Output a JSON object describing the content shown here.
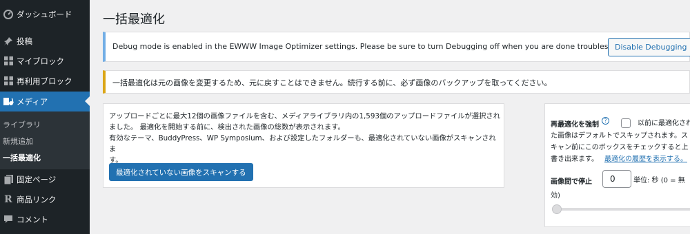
{
  "sidebar": {
    "items": [
      {
        "label": "ダッシュボード",
        "icon": "dashboard-icon"
      },
      {
        "label": "投稿",
        "icon": "pin-icon"
      },
      {
        "label": "マイブロック",
        "icon": "grid-icon"
      },
      {
        "label": "再利用ブロック",
        "icon": "grid-icon"
      },
      {
        "label": "メディア",
        "icon": "media-icon"
      },
      {
        "label": "固定ページ",
        "icon": "page-icon"
      },
      {
        "label": "商品リンク",
        "icon": "r-icon"
      },
      {
        "label": "コメント",
        "icon": "comment-icon"
      }
    ],
    "submenu": [
      "ライブラリ",
      "新規追加",
      "一括最適化"
    ]
  },
  "page_title": "一括最適化",
  "notice_debug": {
    "text": "Debug mode is enabled in the EWWW Image Optimizer settings. Please be sure to turn Debugging off when you are done troubleshooting.",
    "button": "Disable Debugging"
  },
  "notice_warning": {
    "text": "一括最適化は元の画像を変更するため、元に戻すことはできません。続行する前に、必ず画像のバックアップを取ってください。"
  },
  "scan_card": {
    "line1": "アップロードごとに最大12個の画像ファイルを含む、メディアライブラリ内の1,593個のアップロードファイルが選択され",
    "line2": "ました。 最適化を開始する前に、検出された画像の総数が表示されます。",
    "line3": "有効なテーマ、BuddyPress、WP Symposium、および設定したフォルダーも、最適化されていない画像がスキャンされま",
    "line4": "す。",
    "button": "最適化されていない画像をスキャンする"
  },
  "side_panel": {
    "force_label": "再最適化を強制",
    "help": "?",
    "force_desc_1": "以前に最適化され",
    "force_desc_2": "た画像はデフォルトでスキップされます。ス",
    "force_desc_3": "キャン前にこのボックスをチェックすると上",
    "force_desc_4": "書き出来ます。",
    "history_link": "最適化の履歴を表示する。",
    "delay_label": "画像間で停止",
    "delay_value": "0",
    "delay_unit": "単位: 秒 (0 = 無",
    "delay_unit_2": "効)"
  }
}
